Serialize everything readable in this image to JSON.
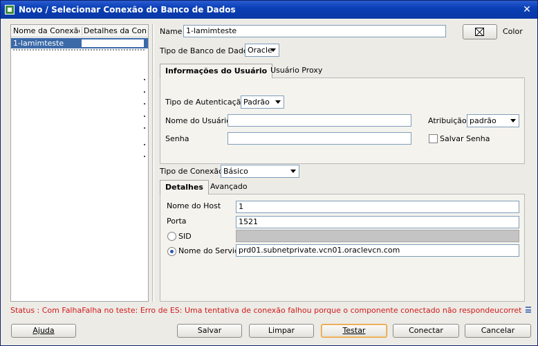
{
  "window": {
    "title": "Novo / Selecionar Conexão do Banco de Dados",
    "close_glyph": "✕"
  },
  "connections": {
    "headers": [
      "Nome da Conexão",
      "Detalhes da Con..."
    ],
    "rows": [
      {
        "name": "1-lamimteste"
      }
    ]
  },
  "form": {
    "name_label": "Name",
    "name_value": "1-lamimteste",
    "color_label": "Color",
    "db_type_label": "Tipo de Banco de Dados",
    "db_type_value": "Oracle"
  },
  "user_tabs": [
    "Informações do Usuário",
    "Usuário Proxy"
  ],
  "auth": {
    "type_label": "Tipo de Autenticação",
    "type_value": "Padrão",
    "user_label": "Nome do Usuário",
    "user_value": "",
    "password_label": "Senha",
    "password_value": "",
    "role_label": "Atribuição",
    "role_value": "padrão",
    "save_password_label": "Salvar Senha",
    "save_password_checked": false
  },
  "connection_type": {
    "label": "Tipo de Conexão",
    "value": "Básico"
  },
  "detail_tabs": [
    "Detalhes",
    "Avançado"
  ],
  "details": {
    "host_label": "Nome do Host",
    "host_value": "1",
    "port_label": "Porta",
    "port_value": "1521",
    "sid_label": "SID",
    "sid_value": "",
    "service_label": "Nome do Serviço",
    "service_value": "prd01.subnetprivate.vcn01.oraclevcn.com",
    "selected_option": "service"
  },
  "status": "Status : Com FalhaFalha no teste: Erro de ES: Uma tentativa de conexão falhou porque o componente conectado não respondeucorretamente após u...",
  "buttons": {
    "help": "Ajuda",
    "save": "Salvar",
    "clear": "Limpar",
    "test": "Testar",
    "connect": "Conectar",
    "cancel": "Cancelar"
  },
  "colors": {
    "titlebar": "#0a3fb5",
    "status_error": "#d11a1a",
    "selection": "#3c6aa8",
    "focus_border": "#e89b3c"
  }
}
